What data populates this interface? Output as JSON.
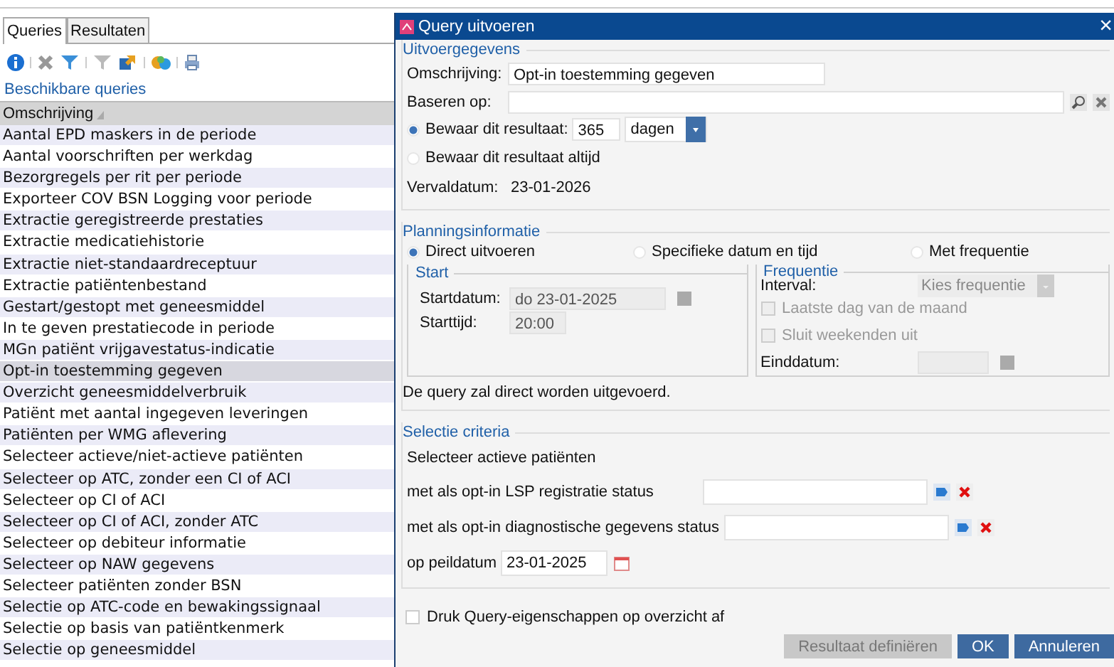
{
  "left_panel": {
    "tabs": [
      {
        "label": "Queries",
        "selected": true
      },
      {
        "label": "Resultaten",
        "selected": false
      }
    ],
    "toolbar": [
      {
        "kind": "info",
        "disabled": false
      },
      {
        "kind": "delete",
        "disabled": true
      },
      {
        "kind": "filter",
        "disabled": false
      },
      {
        "kind": "filter",
        "disabled": true
      },
      {
        "kind": "transfer",
        "disabled": false
      },
      {
        "kind": "shapes",
        "disabled": false
      },
      {
        "kind": "print",
        "disabled": false
      }
    ],
    "section_title": "Beschikbare queries",
    "table": {
      "columns": [
        {
          "label": "Omschrijving"
        }
      ],
      "rows": [
        {
          "label": "Aantal EPD maskers in de periode",
          "selected": false
        },
        {
          "label": "Aantal voorschriften per werkdag",
          "selected": false
        },
        {
          "label": "Bezorgregels per rit per periode",
          "selected": false
        },
        {
          "label": "Exporteer COV BSN Logging voor periode",
          "selected": false
        },
        {
          "label": "Extractie geregistreerde prestaties",
          "selected": false
        },
        {
          "label": "Extractie medicatiehistorie",
          "selected": false
        },
        {
          "label": "Extractie niet-standaardreceptuur",
          "selected": false
        },
        {
          "label": "Extractie patiëntenbestand",
          "selected": false
        },
        {
          "label": "Gestart/gestopt met geneesmiddel",
          "selected": false
        },
        {
          "label": "In te geven prestatiecode in periode",
          "selected": false
        },
        {
          "label": "MGn patiënt vrijgavestatus-indicatie",
          "selected": false
        },
        {
          "label": "Opt-in toestemming gegeven",
          "selected": true
        },
        {
          "label": "Overzicht geneesmiddelverbruik",
          "selected": false
        },
        {
          "label": "Patiënt met aantal ingegeven leveringen",
          "selected": false
        },
        {
          "label": "Patiënten per WMG aflevering",
          "selected": false
        },
        {
          "label": "Selecteer actieve/niet-actieve patiënten",
          "selected": false
        },
        {
          "label": "Selecteer op ATC, zonder een CI of ACI",
          "selected": false
        },
        {
          "label": "Selecteer op CI of ACI",
          "selected": false
        },
        {
          "label": "Selecteer op CI of ACI, zonder ATC",
          "selected": false
        },
        {
          "label": "Selecteer op debiteur informatie",
          "selected": false
        },
        {
          "label": "Selecteer op NAW gegevens",
          "selected": false
        },
        {
          "label": "Selecteer patiënten zonder BSN",
          "selected": false
        },
        {
          "label": "Selectie op ATC-code en bewakingssignaal",
          "selected": false
        },
        {
          "label": "Selectie op basis van patiëntkenmerk",
          "selected": false
        },
        {
          "label": "Selectie op geneesmiddel",
          "selected": false
        }
      ]
    }
  },
  "dialog": {
    "title": "Query uitvoeren",
    "close": "×",
    "output": {
      "legend": "Uitvoergegevens",
      "description": {
        "label": "Omschrijving:",
        "value": "Opt-in toestemming gegeven"
      },
      "based_on": {
        "label": "Baseren op:"
      },
      "retention": [
        {
          "kind": "period",
          "label": "Bewaar dit resultaat:",
          "selected": true,
          "amount": "365",
          "unit": "dagen"
        },
        {
          "kind": "always",
          "label": "Bewaar dit resultaat altijd",
          "selected": false
        }
      ],
      "expiry": {
        "label": "Vervaldatum:",
        "value": "23-01-2026"
      }
    },
    "planning": {
      "legend": "Planningsinformatie",
      "modes": [
        {
          "label": "Direct uitvoeren",
          "selected": true
        },
        {
          "label": "Specifieke datum en tijd",
          "selected": false
        },
        {
          "label": "Met frequentie",
          "selected": false
        }
      ],
      "start": {
        "legend": "Start",
        "date_label": "Startdatum:",
        "date": "do 23-01-2025",
        "time_label": "Starttijd:",
        "time": "20:00",
        "disabled": true
      },
      "frequency": {
        "legend": "Frequentie",
        "interval_label": "Interval:",
        "interval": "Kies frequentie",
        "disabled": true,
        "options": [
          {
            "label": "Laatste dag van de maand",
            "checked": false
          },
          {
            "label": "Sluit weekenden uit",
            "checked": false
          }
        ],
        "end_label": "Einddatum:"
      },
      "note": "De query zal direct worden uitgevoerd."
    },
    "criteria": {
      "legend": "Selectie criteria",
      "heading": "Selecteer actieve patiënten",
      "fields": [
        {
          "kind": "lookup",
          "label": "met als opt-in LSP registratie status"
        },
        {
          "kind": "lookup",
          "label": "met als opt-in diagnostische gegevens status"
        },
        {
          "kind": "date",
          "label": "op peildatum",
          "value": "23-01-2025"
        }
      ]
    },
    "print_option": {
      "label": "Druk Query-eigenschappen op overzicht af",
      "checked": false
    },
    "buttons": [
      {
        "label": "Resultaat definiëren",
        "disabled": true
      },
      {
        "label": "OK",
        "disabled": false
      },
      {
        "label": "Annuleren",
        "disabled": false
      }
    ]
  }
}
